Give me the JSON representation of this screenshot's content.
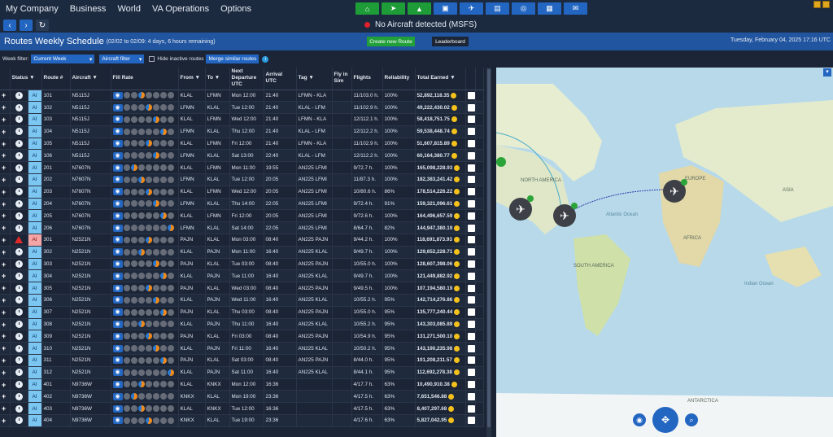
{
  "menu": [
    "My Company",
    "Business",
    "World",
    "VA Operations",
    "Options"
  ],
  "status": {
    "text": "No Aircraft detected (MSFS)"
  },
  "header": {
    "title": "Routes Weekly Schedule",
    "subtitle": "(02/02 to 02/09: 4 days, 6 hours remaining)",
    "create_label": "Create new Route",
    "leaderboard_label": "Leaderboard",
    "date": "Tuesday, February 04, 2025 17:16 UTC"
  },
  "filters": {
    "week_label": "Week filter:",
    "week_value": "Current Week",
    "aircraft_filter": "Aircraft filter",
    "hide_inactive": "Hide inactive routes",
    "merge": "Merge similar routes"
  },
  "columns": {
    "status": "Status",
    "route": "Route #",
    "aircraft": "Aircraft",
    "fill": "Fill Rate",
    "from": "From",
    "to": "To",
    "next": "Next Departure UTC",
    "arrival": "Arrival UTC",
    "tag": "Tag",
    "fly": "Fly in Sim",
    "flights": "Flights",
    "reliability": "Reliability",
    "earned": "Total Earned"
  },
  "rows": [
    {
      "st": "AI",
      "route": "101",
      "ac": "N5115J",
      "from": "KLAL",
      "to": "LFMN",
      "next": "Mon 12:00",
      "arr": "21:40",
      "tag": "LFMN - KLA",
      "flights": "11/103.0 h.",
      "rel": "100%",
      "earned": "52,892,118.35"
    },
    {
      "st": "AI",
      "route": "102",
      "ac": "N5115J",
      "from": "LFMN",
      "to": "KLAL",
      "next": "Tue 12:00",
      "arr": "21:40",
      "tag": "KLAL - LFM",
      "flights": "11/102.9 h.",
      "rel": "100%",
      "earned": "49,222,430.02"
    },
    {
      "st": "AI",
      "route": "103",
      "ac": "N5115J",
      "from": "KLAL",
      "to": "LFMN",
      "next": "Wed 12:00",
      "arr": "21:40",
      "tag": "LFMN - KLA",
      "flights": "12/112.1 h.",
      "rel": "100%",
      "earned": "58,418,751.75"
    },
    {
      "st": "AI",
      "route": "104",
      "ac": "N5115J",
      "from": "LFMN",
      "to": "KLAL",
      "next": "Thu 12:00",
      "arr": "21:40",
      "tag": "KLAL - LFM",
      "flights": "12/112.2 h.",
      "rel": "100%",
      "earned": "59,538,448.74"
    },
    {
      "st": "AI",
      "route": "105",
      "ac": "N5115J",
      "from": "KLAL",
      "to": "LFMN",
      "next": "Fri 12:00",
      "arr": "21:40",
      "tag": "LFMN - KLA",
      "flights": "11/102.9 h.",
      "rel": "100%",
      "earned": "51,607,815.89"
    },
    {
      "st": "AI",
      "route": "106",
      "ac": "N5115J",
      "from": "LFMN",
      "to": "KLAL",
      "next": "Sat 13:00",
      "arr": "22:40",
      "tag": "KLAL - LFM",
      "flights": "12/112.2 h.",
      "rel": "100%",
      "earned": "60,164,380.77"
    },
    {
      "st": "AI",
      "route": "201",
      "ac": "N7607N",
      "from": "KLAL",
      "to": "LFMN",
      "next": "Mon 11:00",
      "arr": "19:55",
      "tag": "AN225 LFMI",
      "flights": "9/72.7 h.",
      "rel": "100%",
      "earned": "165,098,228.93"
    },
    {
      "st": "AI",
      "route": "202",
      "ac": "N7607N",
      "from": "LFMN",
      "to": "KLAL",
      "next": "Tue 12:00",
      "arr": "20:05",
      "tag": "AN225 LFMI",
      "flights": "11/87.3 h.",
      "rel": "100%",
      "earned": "182,383,241.42"
    },
    {
      "st": "AI",
      "route": "203",
      "ac": "N7607N",
      "from": "KLAL",
      "to": "LFMN",
      "next": "Wed 12:00",
      "arr": "20:05",
      "tag": "AN225 LFMI",
      "flights": "10/80.6 h.",
      "rel": "86%",
      "earned": "178,514,226.22"
    },
    {
      "st": "AI",
      "route": "204",
      "ac": "N7607N",
      "from": "LFMN",
      "to": "KLAL",
      "next": "Thu 14:00",
      "arr": "22:05",
      "tag": "AN225 LFMI",
      "flights": "9/72.4 h.",
      "rel": "91%",
      "earned": "159,321,096.61"
    },
    {
      "st": "AI",
      "route": "205",
      "ac": "N7607N",
      "from": "KLAL",
      "to": "LFMN",
      "next": "Fri 12:00",
      "arr": "20:05",
      "tag": "AN225 LFMI",
      "flights": "9/72.6 h.",
      "rel": "100%",
      "earned": "164,496,657.59"
    },
    {
      "st": "AI",
      "route": "206",
      "ac": "N7607N",
      "from": "LFMN",
      "to": "KLAL",
      "next": "Sat 14:00",
      "arr": "22:05",
      "tag": "AN225 LFMI",
      "flights": "8/64.7 h.",
      "rel": "82%",
      "earned": "144,947,380.19"
    },
    {
      "st": "AI",
      "route": "301",
      "ac": "N2521N",
      "from": "PAJN",
      "to": "KLAL",
      "next": "Mon 03:00",
      "arr": "08:40",
      "tag": "AN225 PAJN",
      "flights": "9/44.2 h.",
      "rel": "100%",
      "earned": "118,691,873.93",
      "warn": true
    },
    {
      "st": "AI",
      "route": "302",
      "ac": "N2521N",
      "from": "KLAL",
      "to": "PAJN",
      "next": "Mon 11:00",
      "arr": "16:40",
      "tag": "AN225 KLAL",
      "flights": "9/49.7 h.",
      "rel": "100%",
      "earned": "129,652,228.71"
    },
    {
      "st": "AI",
      "route": "303",
      "ac": "N2521N",
      "from": "PAJN",
      "to": "KLAL",
      "next": "Tue 03:00",
      "arr": "08:40",
      "tag": "AN225 PAJN",
      "flights": "10/55.0 h.",
      "rel": "100%",
      "earned": "128,607,398.06"
    },
    {
      "st": "AI",
      "route": "304",
      "ac": "N2521N",
      "from": "KLAL",
      "to": "PAJN",
      "next": "Tue 11:00",
      "arr": "16:40",
      "tag": "AN225 KLAL",
      "flights": "9/49.7 h.",
      "rel": "100%",
      "earned": "121,449,882.92"
    },
    {
      "st": "AI",
      "route": "305",
      "ac": "N2521N",
      "from": "PAJN",
      "to": "KLAL",
      "next": "Wed 03:00",
      "arr": "08:40",
      "tag": "AN225 PAJN",
      "flights": "9/49.5 h.",
      "rel": "100%",
      "earned": "107,194,580.19"
    },
    {
      "st": "AI",
      "route": "306",
      "ac": "N2521N",
      "from": "KLAL",
      "to": "PAJN",
      "next": "Wed 11:00",
      "arr": "16:40",
      "tag": "AN225 KLAL",
      "flights": "10/55.2 h.",
      "rel": "95%",
      "earned": "142,714,276.86"
    },
    {
      "st": "AI",
      "route": "307",
      "ac": "N2521N",
      "from": "PAJN",
      "to": "KLAL",
      "next": "Thu 03:00",
      "arr": "08:40",
      "tag": "AN225 PAJN",
      "flights": "10/55.0 h.",
      "rel": "95%",
      "earned": "135,777,240.44"
    },
    {
      "st": "AI",
      "route": "308",
      "ac": "N2521N",
      "from": "KLAL",
      "to": "PAJN",
      "next": "Thu 11:00",
      "arr": "16:40",
      "tag": "AN225 KLAL",
      "flights": "10/55.2 h.",
      "rel": "95%",
      "earned": "143,303,085.89"
    },
    {
      "st": "AI",
      "route": "309",
      "ac": "N2521N",
      "from": "PAJN",
      "to": "KLAL",
      "next": "Fri 03:00",
      "arr": "08:40",
      "tag": "AN225 PAJN",
      "flights": "10/54.9 h.",
      "rel": "95%",
      "earned": "131,271,500.10"
    },
    {
      "st": "AI",
      "route": "310",
      "ac": "N2521N",
      "from": "KLAL",
      "to": "PAJN",
      "next": "Fri 11:00",
      "arr": "16:40",
      "tag": "AN225 KLAL",
      "flights": "10/50.2 h.",
      "rel": "95%",
      "earned": "143,190,235.98"
    },
    {
      "st": "AI",
      "route": "311",
      "ac": "N2521N",
      "from": "PAJN",
      "to": "KLAL",
      "next": "Sat 03:00",
      "arr": "08:40",
      "tag": "AN225 PAJN",
      "flights": "8/44.0 h.",
      "rel": "95%",
      "earned": "101,208,211.57"
    },
    {
      "st": "AI",
      "route": "312",
      "ac": "N2521N",
      "from": "KLAL",
      "to": "PAJN",
      "next": "Sat 11:00",
      "arr": "16:40",
      "tag": "AN225 KLAL",
      "flights": "8/44.1 h.",
      "rel": "95%",
      "earned": "112,692,278.38"
    },
    {
      "st": "AI",
      "route": "401",
      "ac": "N9736W",
      "from": "KLAL",
      "to": "KNKX",
      "next": "Mon 12:00",
      "arr": "16:36",
      "tag": "",
      "flights": "4/17.7 h.",
      "rel": "63%",
      "earned": "10,490,910.38"
    },
    {
      "st": "AI",
      "route": "402",
      "ac": "N9736W",
      "from": "KNKX",
      "to": "KLAL",
      "next": "Mon 19:00",
      "arr": "23:36",
      "tag": "",
      "flights": "4/17.5 h.",
      "rel": "63%",
      "earned": "7,651,546.88"
    },
    {
      "st": "AI",
      "route": "403",
      "ac": "N9736W",
      "from": "KLAL",
      "to": "KNKX",
      "next": "Tue 12:00",
      "arr": "16:36",
      "tag": "",
      "flights": "4/17.5 h.",
      "rel": "63%",
      "earned": "8,407,297.68"
    },
    {
      "st": "AI",
      "route": "404",
      "ac": "N9736W",
      "from": "KNKX",
      "to": "KLAL",
      "next": "Tue 19:00",
      "arr": "23:36",
      "tag": "",
      "flights": "4/17.6 h.",
      "rel": "63%",
      "earned": "5,827,042.95"
    }
  ],
  "map": {
    "labels": {
      "na": "NORTH AMERICA",
      "eu": "EUROPE",
      "asia": "ASIA",
      "africa": "AFRICA",
      "sa": "SOUTH AMERICA",
      "ant": "ANTARCTICA",
      "atl": "Atlantic Ocean",
      "ind": "Indian Ocean"
    }
  },
  "colors": {
    "accent": "#2366c2",
    "green": "#21a03a",
    "ai_bg": "#7cc6f2",
    "warn_bg": "#f4a5a5"
  }
}
